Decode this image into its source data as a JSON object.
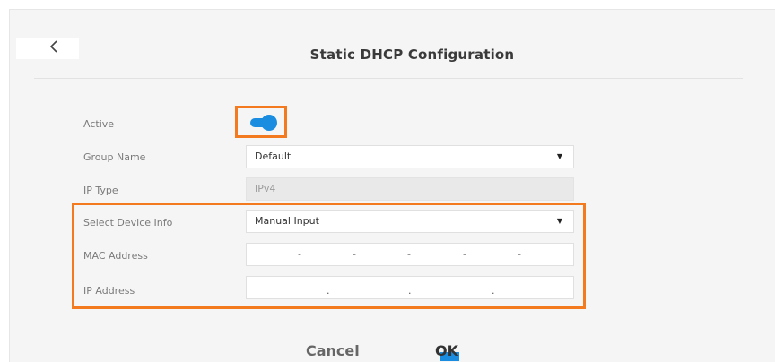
{
  "header": {
    "title": "Static DHCP Configuration"
  },
  "form": {
    "active_label": "Active",
    "active_state": true,
    "group_name_label": "Group Name",
    "group_name_value": "Default",
    "ip_type_label": "IP Type",
    "ip_type_value": "IPv4",
    "select_device_label": "Select Device Info",
    "select_device_value": "Manual Input",
    "mac_label": "MAC Address",
    "mac_separators": [
      "-",
      "-",
      "-",
      "-",
      "-"
    ],
    "ip_label": "IP Address",
    "ip_separators": [
      ".",
      ".",
      "."
    ]
  },
  "actions": {
    "cancel_label": "Cancel",
    "ok_label": "OK"
  },
  "colors": {
    "accent": "#1a8de0",
    "highlight": "#f47a20"
  },
  "icons": {
    "back": "chevron-left-icon",
    "dropdown": "caret-down-icon"
  }
}
